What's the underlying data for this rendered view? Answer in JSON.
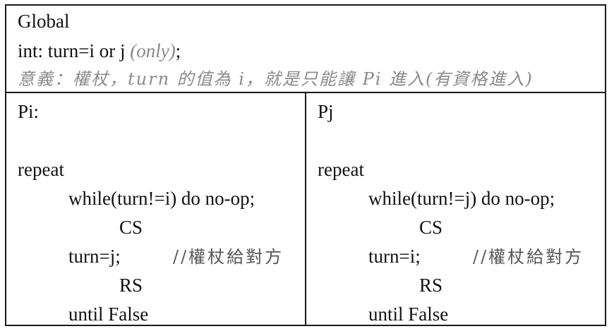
{
  "global": {
    "title": "Global",
    "decl_main": "int: turn=i or j ",
    "decl_only": "(only)",
    "decl_end": ";",
    "note": "意義：權杖，turn 的值為 i，就是只能讓 Pi 進入(有資格進入)"
  },
  "left": {
    "header": "Pi:",
    "repeat": "repeat",
    "while": "while(turn!=i) do no-op;",
    "cs": "CS",
    "assign": "turn=j;",
    "comment": "//權杖給對方",
    "rs": "RS",
    "until": "until False"
  },
  "right": {
    "header": "Pj",
    "repeat": "repeat",
    "while": "while(turn!=j) do no-op;",
    "cs": "CS",
    "assign": "turn=i;",
    "comment": "//權杖給對方",
    "rs": "RS",
    "until": "until False"
  }
}
